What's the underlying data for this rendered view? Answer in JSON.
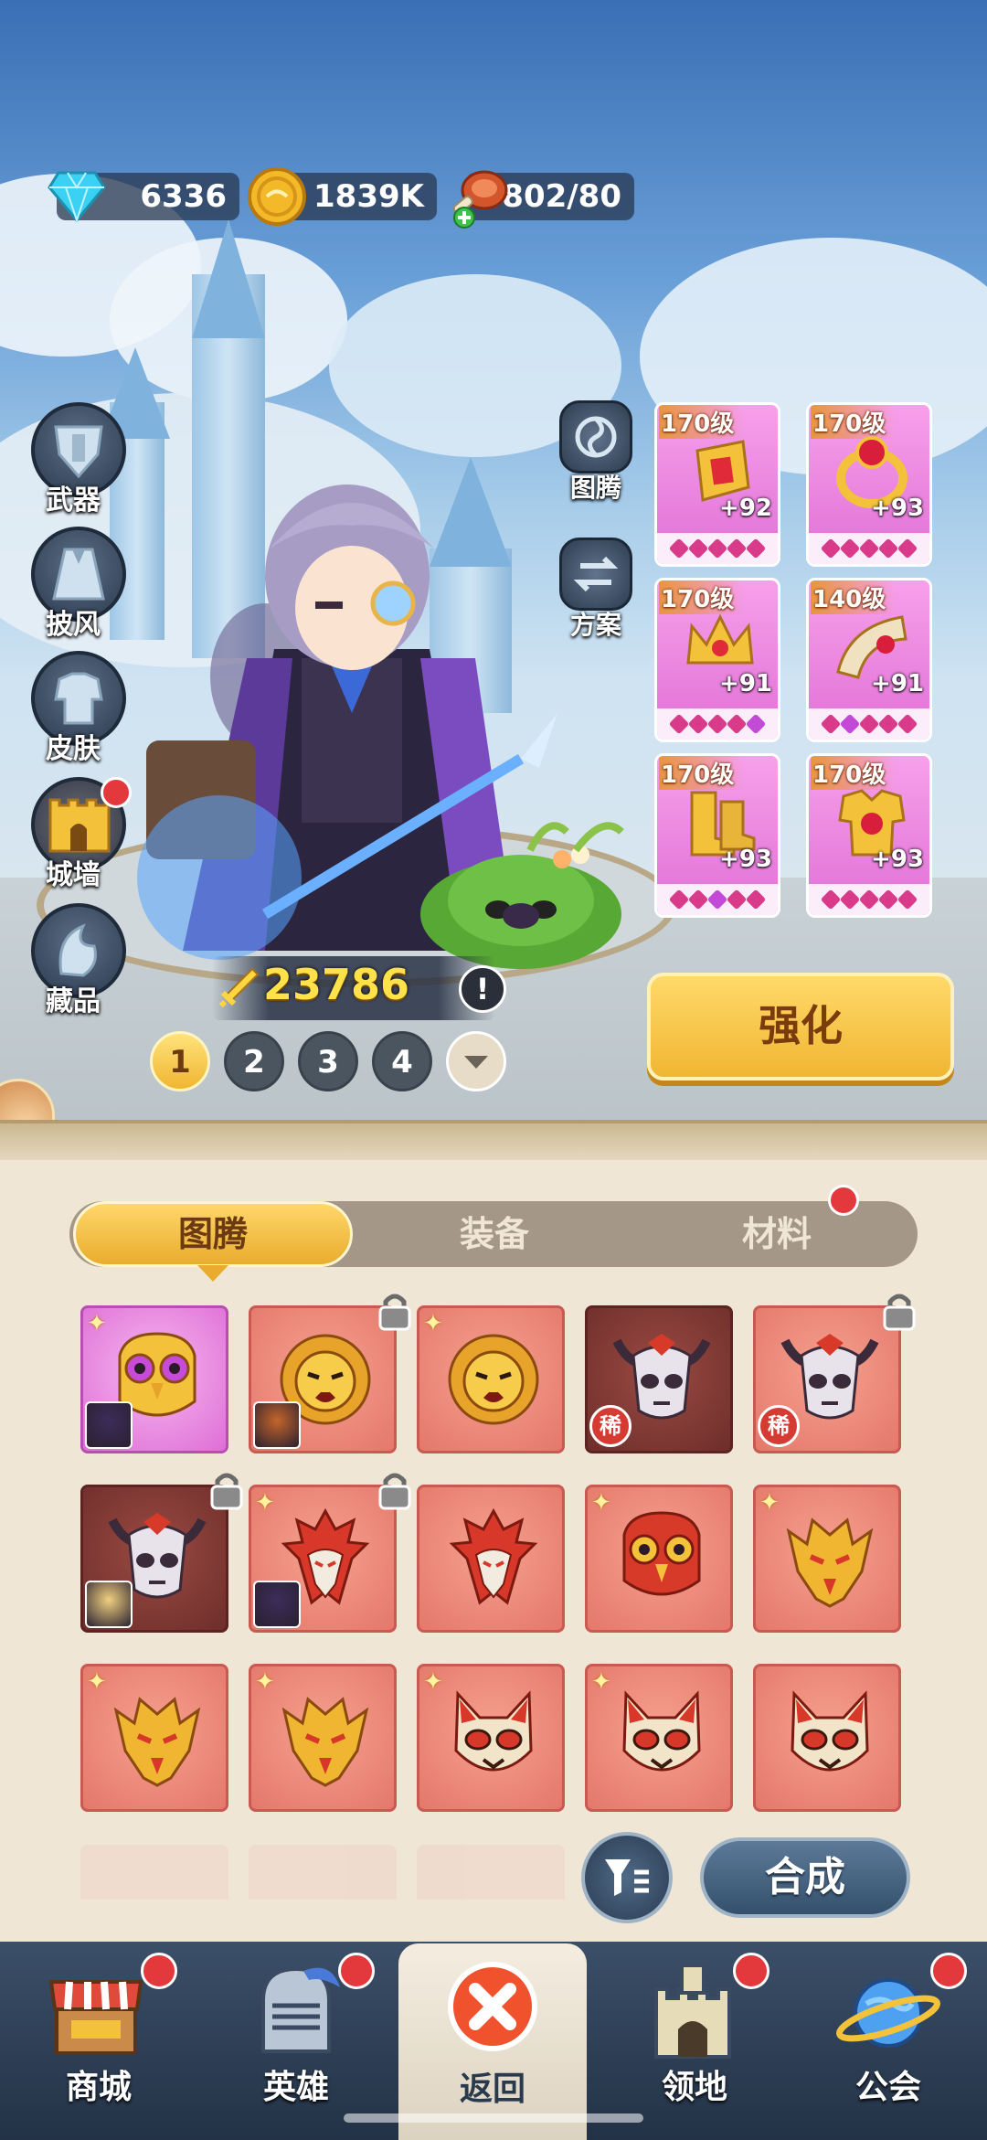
{
  "resources": {
    "diamonds": "6336",
    "gold": "1839K",
    "stamina": "802/80"
  },
  "side_menu": [
    {
      "label": "武器",
      "icon": "shield-armor-icon"
    },
    {
      "label": "披风",
      "icon": "cape-icon"
    },
    {
      "label": "皮肤",
      "icon": "outfit-icon"
    },
    {
      "label": "城墙",
      "icon": "castle-wall-icon",
      "badge": true
    },
    {
      "label": "藏品",
      "icon": "collection-icon"
    }
  ],
  "right_menu": [
    {
      "label": "图腾",
      "icon": "totem-swirl-icon"
    },
    {
      "label": "方案",
      "icon": "loadout-swap-icon"
    }
  ],
  "equipment": [
    {
      "level": "170级",
      "plus": "+92",
      "item": "totem-gem-icon"
    },
    {
      "level": "170级",
      "plus": "+93",
      "item": "ruby-ring-icon"
    },
    {
      "level": "170级",
      "plus": "+91",
      "item": "crown-helmet-icon"
    },
    {
      "level": "140级",
      "plus": "+91",
      "item": "horn-icon"
    },
    {
      "level": "170级",
      "plus": "+93",
      "item": "golden-boots-icon"
    },
    {
      "level": "170级",
      "plus": "+93",
      "item": "chest-armor-icon"
    }
  ],
  "power": "23786",
  "enhance_label": "强化",
  "pages": [
    "1",
    "2",
    "3",
    "4"
  ],
  "tabs": [
    "图腾",
    "装备",
    "材料"
  ],
  "inventory": [
    {
      "mask": "owl",
      "style": "purple",
      "star": true,
      "avatar": "dark-hero",
      "lock": false
    },
    {
      "mask": "lion",
      "style": "red",
      "star": false,
      "avatar": "boy-hero",
      "lock": true
    },
    {
      "mask": "lion",
      "style": "red",
      "star": true,
      "lock": false
    },
    {
      "mask": "horned-skull",
      "style": "dark",
      "star": false,
      "rare": "稀",
      "lock": false
    },
    {
      "mask": "horned-skull",
      "style": "red",
      "star": false,
      "rare": "稀",
      "lock": true
    },
    {
      "mask": "horned-skull",
      "style": "dark",
      "star": false,
      "avatar": "elf-hero",
      "lock": true
    },
    {
      "mask": "phoenix",
      "style": "red",
      "star": true,
      "avatar": "dark-hero",
      "lock": true
    },
    {
      "mask": "phoenix",
      "style": "red",
      "star": false,
      "lock": false
    },
    {
      "mask": "owl-red",
      "style": "red",
      "star": true,
      "lock": false
    },
    {
      "mask": "dragon",
      "style": "red",
      "star": true,
      "lock": false
    },
    {
      "mask": "dragon",
      "style": "red",
      "star": true,
      "lock": false
    },
    {
      "mask": "dragon",
      "style": "red",
      "star": true,
      "lock": false
    },
    {
      "mask": "cat",
      "style": "red",
      "star": true,
      "lock": false
    },
    {
      "mask": "cat",
      "style": "red",
      "star": true,
      "lock": false
    },
    {
      "mask": "cat",
      "style": "red",
      "star": false,
      "lock": false
    }
  ],
  "combine_label": "合成",
  "nav": [
    {
      "label": "商城",
      "icon": "shop-icon",
      "badge": true
    },
    {
      "label": "英雄",
      "icon": "knight-helmet-icon",
      "badge": true
    },
    {
      "label": "返回",
      "icon": "close-icon",
      "active": true
    },
    {
      "label": "领地",
      "icon": "castle-icon",
      "badge": true
    },
    {
      "label": "公会",
      "icon": "planet-icon",
      "badge": true
    }
  ],
  "colors": {
    "accent_gold": "#f0b632",
    "badge_red": "#e4393c",
    "card_red": "#e4786b",
    "card_purple": "#de6fd6"
  }
}
